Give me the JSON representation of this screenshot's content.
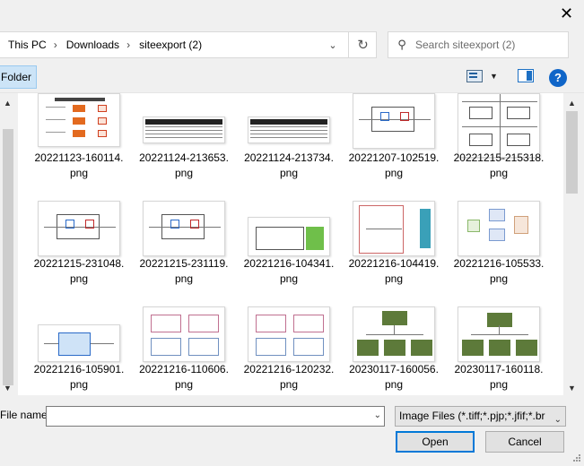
{
  "window": {
    "close_glyph": "✕"
  },
  "address_bar": {
    "crumbs": [
      "This PC",
      "Downloads",
      "siteexport (2)"
    ],
    "separator": "›",
    "dropdown_glyph": "⌄",
    "refresh_glyph": "↻"
  },
  "search": {
    "placeholder": "Search siteexport (2)",
    "icon_glyph": "⚲"
  },
  "toolbar": {
    "new_folder_label": "Folder",
    "view_dropdown_glyph": "▼",
    "help_glyph": "?"
  },
  "files": [
    {
      "line1": "20221123-160114.",
      "line2": "png",
      "thumb": "safety"
    },
    {
      "line1": "20221124-213653.",
      "line2": "png",
      "thumb": "table"
    },
    {
      "line1": "20221124-213734.",
      "line2": "png",
      "thumb": "table"
    },
    {
      "line1": "20221207-102519.",
      "line2": "png",
      "thumb": "circuit"
    },
    {
      "line1": "20221215-215318.",
      "line2": "png",
      "thumb": "grid"
    },
    {
      "line1": "20221215-231048.",
      "line2": "png",
      "thumb": "circuit"
    },
    {
      "line1": "20221215-231119.",
      "line2": "png",
      "thumb": "circuit"
    },
    {
      "line1": "20221216-104341.",
      "line2": "png",
      "thumb": "green"
    },
    {
      "line1": "20221216-104419.",
      "line2": "png",
      "thumb": "teal"
    },
    {
      "line1": "20221216-105533.",
      "line2": "png",
      "thumb": "blocks"
    },
    {
      "line1": "20221216-105901.",
      "line2": "png",
      "thumb": "blue"
    },
    {
      "line1": "20221216-110606.",
      "line2": "png",
      "thumb": "pink"
    },
    {
      "line1": "20221216-120232.",
      "line2": "png",
      "thumb": "pink"
    },
    {
      "line1": "20230117-160056.",
      "line2": "png",
      "thumb": "tree"
    },
    {
      "line1": "20230117-160118.",
      "line2": "png",
      "thumb": "tree2"
    }
  ],
  "bottom": {
    "filename_label": "File name:",
    "filename_value": "",
    "filetype_value": "Image Files (*.tiff;*.pjp;*.jfif;*.br",
    "open_label": "Open",
    "cancel_label": "Cancel",
    "dropdown_glyph": "⌄"
  },
  "scroll": {
    "up_glyph": "▲",
    "down_glyph": "▼"
  },
  "colors": {
    "accent": "#0078d7",
    "selection_bg": "#cce4f7",
    "help_blue": "#0f65c8",
    "tree_green": "#5d7a3a"
  }
}
